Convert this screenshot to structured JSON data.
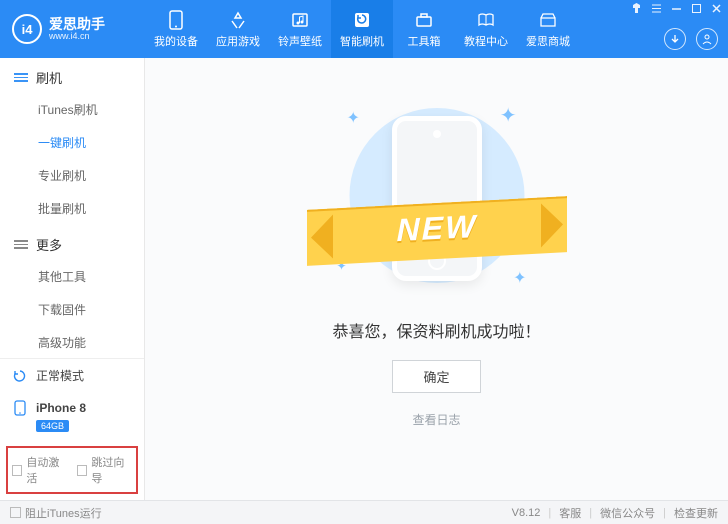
{
  "brand": {
    "name": "爱思助手",
    "url": "www.i4.cn",
    "logo_letters": "i4"
  },
  "tabs": [
    {
      "id": "device",
      "label": "我的设备"
    },
    {
      "id": "games",
      "label": "应用游戏"
    },
    {
      "id": "ringtone",
      "label": "铃声壁纸"
    },
    {
      "id": "flash",
      "label": "智能刷机",
      "active": true
    },
    {
      "id": "toolbox",
      "label": "工具箱"
    },
    {
      "id": "tutorial",
      "label": "教程中心"
    },
    {
      "id": "mall",
      "label": "爱思商城"
    }
  ],
  "sidebar": {
    "group1": {
      "title": "刷机",
      "items": [
        "iTunes刷机",
        "一键刷机",
        "专业刷机",
        "批量刷机"
      ],
      "activeIndex": 1
    },
    "group2": {
      "title": "更多",
      "items": [
        "其他工具",
        "下载固件",
        "高级功能"
      ]
    },
    "mode": "正常模式",
    "device": {
      "name": "iPhone 8",
      "storage": "64GB"
    },
    "checks": {
      "auto_activate": "自动激活",
      "skip_guide": "跳过向导"
    }
  },
  "main": {
    "banner_text": "NEW",
    "success": "恭喜您，保资料刷机成功啦！",
    "ok": "确定",
    "view_log": "查看日志"
  },
  "footer": {
    "block_itunes": "阻止iTunes运行",
    "version": "V8.12",
    "links": [
      "客服",
      "微信公众号",
      "检查更新"
    ]
  }
}
